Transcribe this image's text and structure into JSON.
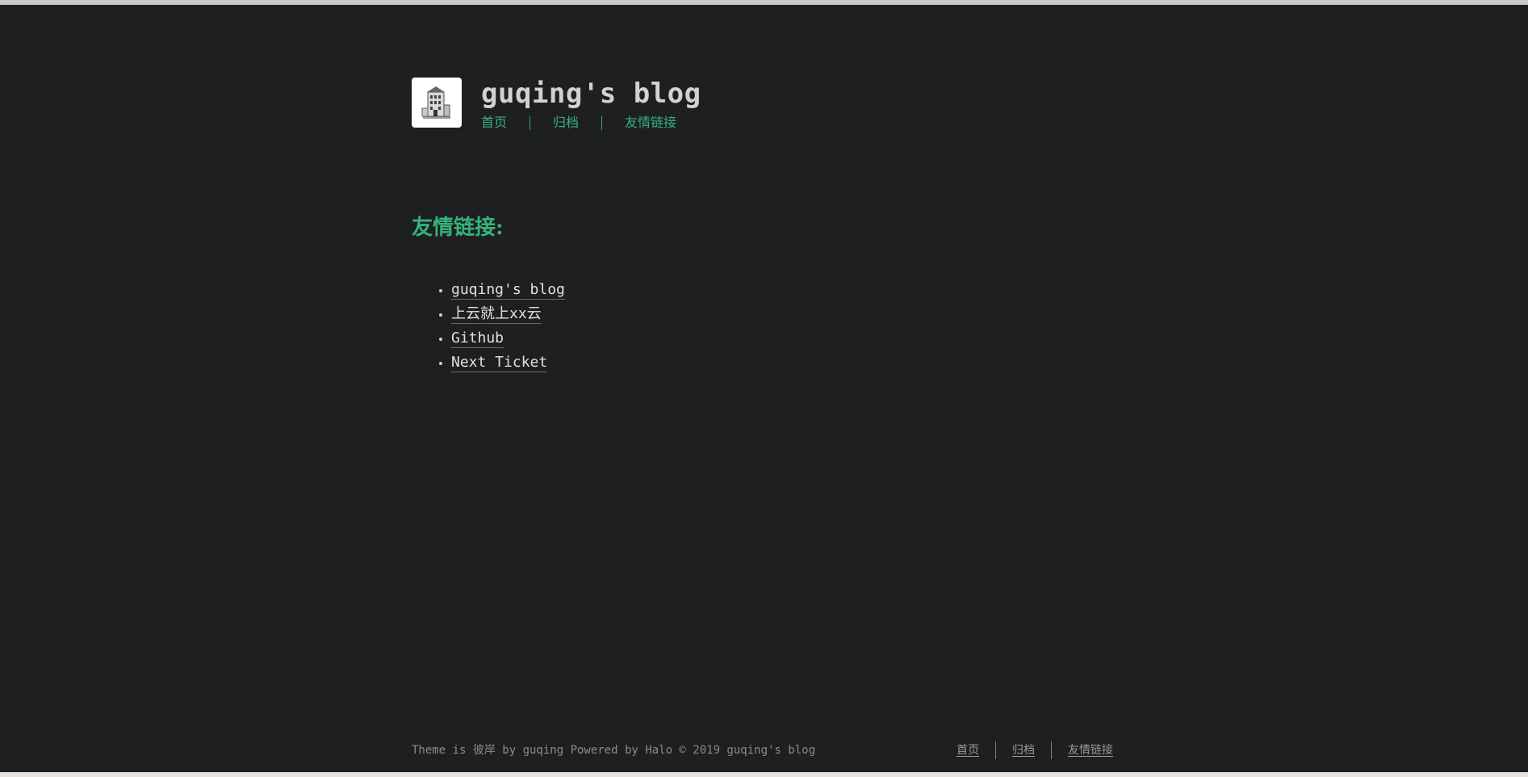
{
  "site": {
    "title": "guqing's blog"
  },
  "nav": {
    "items": [
      {
        "label": "首页"
      },
      {
        "label": "归档"
      },
      {
        "label": "友情链接"
      }
    ]
  },
  "page": {
    "heading": "友情链接:"
  },
  "links": {
    "items": [
      {
        "label": "guqing's blog"
      },
      {
        "label": "上云就上xx云"
      },
      {
        "label": "Github"
      },
      {
        "label": "Next Ticket"
      }
    ]
  },
  "footer": {
    "text": "Theme is 彼岸 by guqing Powered by Halo © 2019 guqing's blog",
    "nav": [
      {
        "label": "首页"
      },
      {
        "label": "归档"
      },
      {
        "label": "友情链接"
      }
    ]
  },
  "colors": {
    "background": "#1e1f21",
    "accent": "#35b27d",
    "text": "#d5d5d5",
    "muted": "#8b8b8b"
  },
  "icons": {
    "logo": "building-logo-icon"
  }
}
